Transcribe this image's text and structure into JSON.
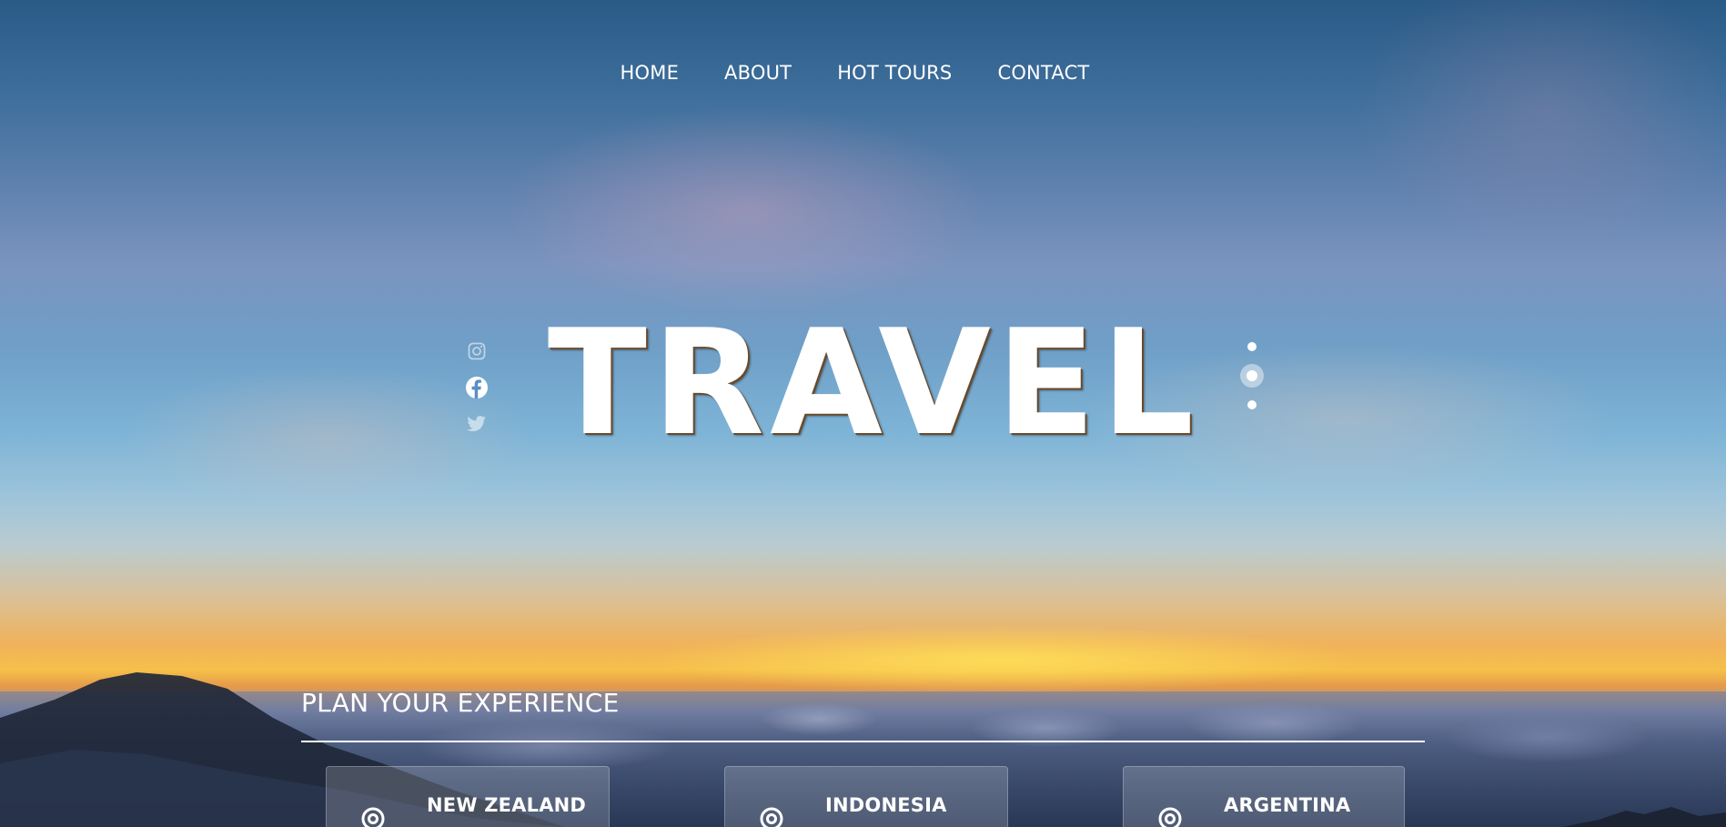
{
  "nav": {
    "items": [
      {
        "label": "HOME"
      },
      {
        "label": "ABOUT"
      },
      {
        "label": "HOT TOURS"
      },
      {
        "label": "CONTACT"
      }
    ]
  },
  "hero": {
    "title": "TRAVEL",
    "social_icons": [
      "instagram-icon",
      "facebook-icon",
      "twitter-icon"
    ],
    "slider": {
      "slides": 3,
      "active_index": 2
    }
  },
  "plan": {
    "heading": "PLAN YOUR EXPERIENCE",
    "destinations": [
      {
        "name": "NEW ZEALAND",
        "icon": "location-target-icon"
      },
      {
        "name": "INDONESIA",
        "icon": "location-target-icon"
      },
      {
        "name": "ARGENTINA",
        "icon": "location-target-icon"
      }
    ]
  },
  "colors": {
    "text": "#ffffff",
    "title_shadow": "#6a4a2a",
    "card_bg": "rgba(255,255,255,0.18)"
  }
}
